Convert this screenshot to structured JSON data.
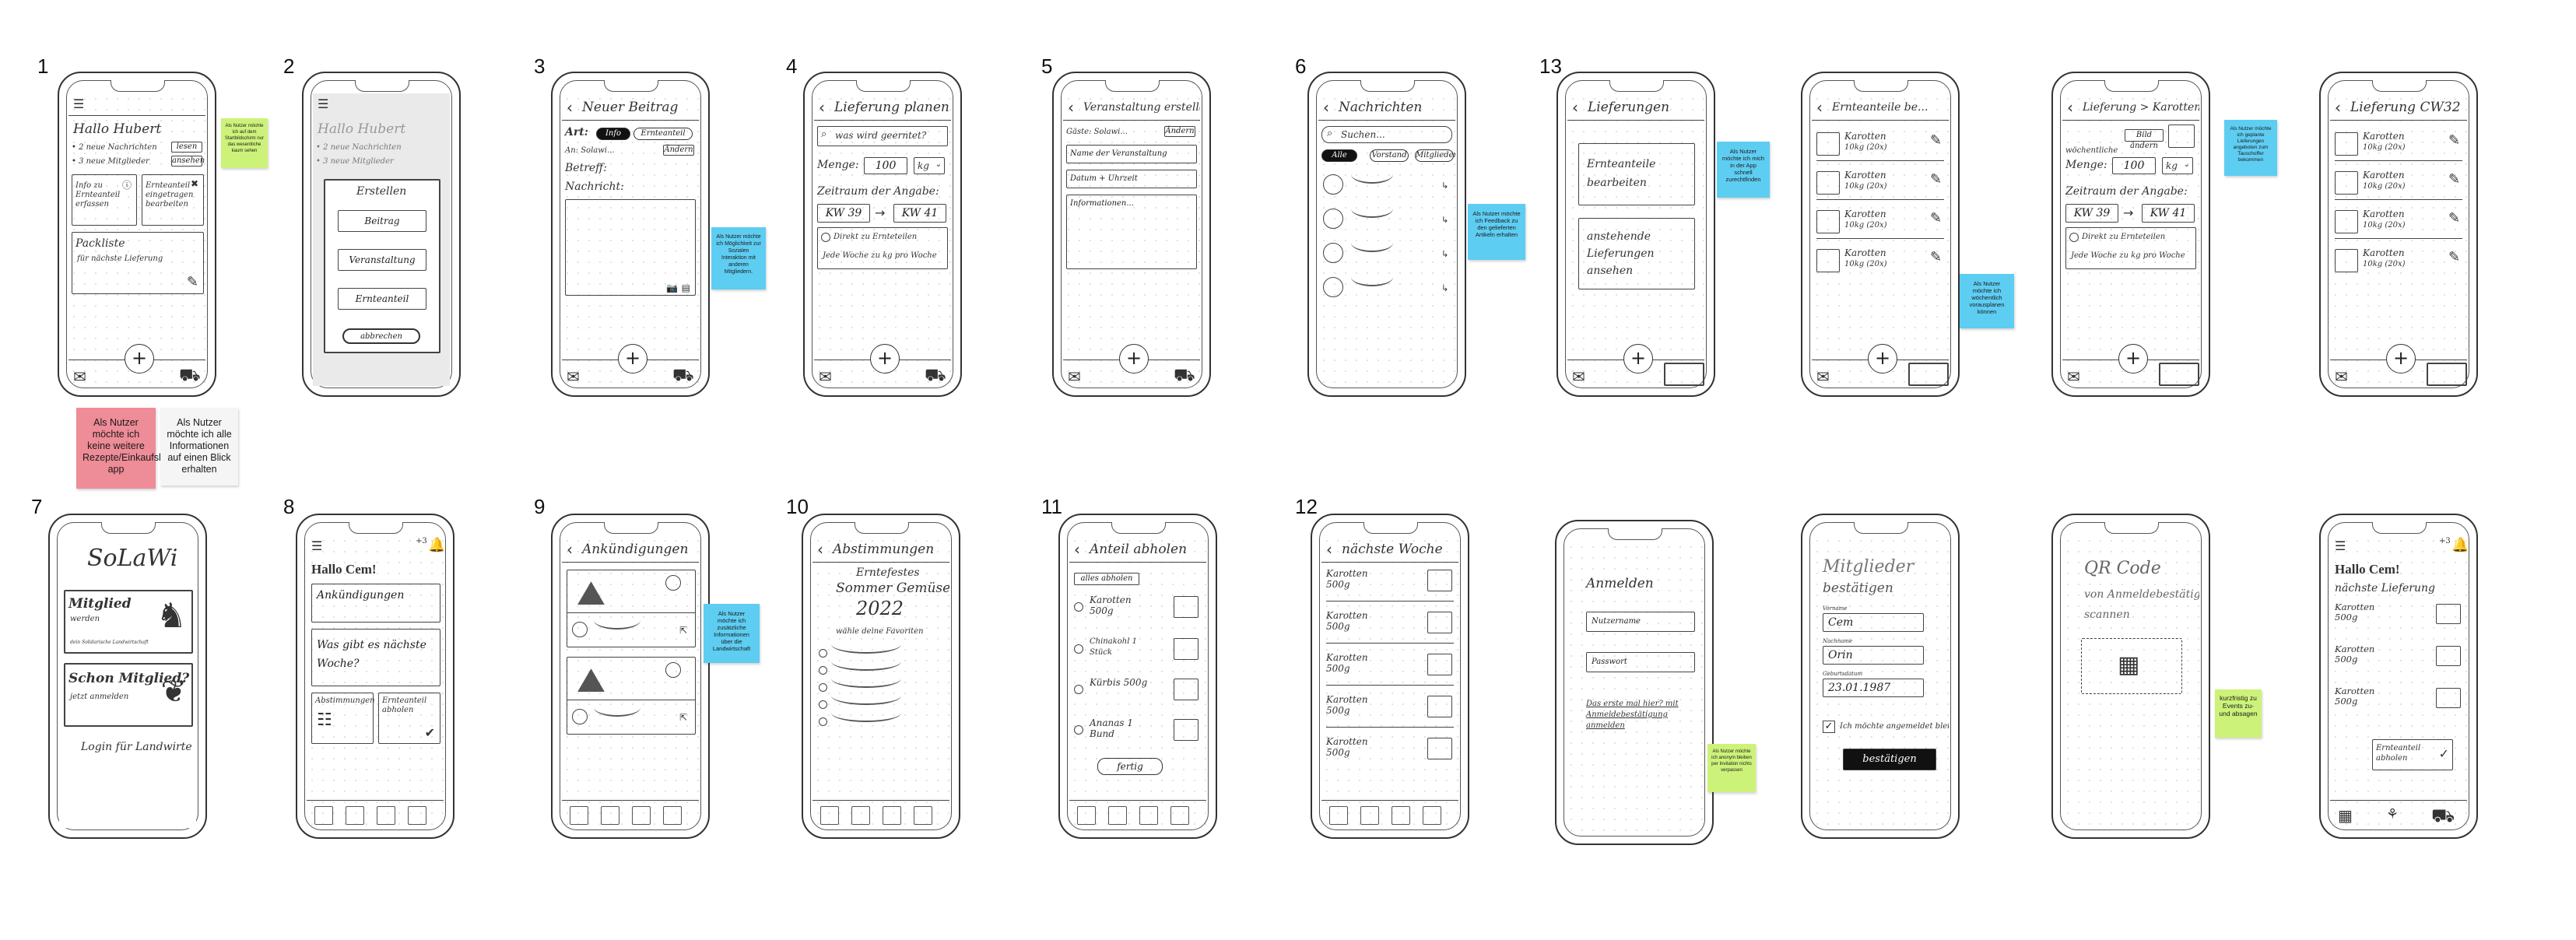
{
  "canvas_title": "",
  "labels": {
    "n1": "1",
    "n2": "2",
    "n3": "3",
    "n4": "4",
    "n5": "5",
    "n6": "6",
    "n13": "13",
    "n7": "7",
    "n8": "8",
    "n9": "9",
    "n10": "10",
    "n11": "11",
    "n12": "12"
  },
  "notes": {
    "s1_green": "Als Nutzer möchte ich auf dem Startbildschirm nur das wesentliche kaum sehen",
    "s3_blue": "Als Nutzer möchte ich Möglichkeit zur Sozialen Interaktion mit anderen Mitgliedern.",
    "s6_blue": "Als Nutzer möchte ich Feedback zu den gelieferten Artikeln erhalten",
    "s13_blue": "Als Nutzer möchte ich mich in der App schnell zurechtfinden",
    "s15_blue": "Als Nutzer möchte ich wöchentlich vorausplanen können",
    "s17_blue": "Als Nutzer möchte ich geplante Lieferungen angeboten zum Tauschoffer bekommen",
    "pink": "Als Nutzer möchte ich keine weitere Rezepte/Einkaufslisten app",
    "white": "Als Nutzer möchte ich alle Informationen auf einen Blick erhalten",
    "s9_blue": "Als Nutzer möchte ich zusätzliche Informationen über die Landwirtschaft",
    "s13b_green": "Als Nutzer möchte ich anonym bleiben per Invitation nichts verpassen",
    "s16_green": "kurzfristig zu Events zu- und absagen"
  },
  "s1": {
    "greeting": "Hallo Hubert",
    "line1": "• 2 neue Nachrichten",
    "line2": "• 3 neue Mitglieder",
    "btn_lesen": "lesen",
    "btn_ansehen": "ansehen",
    "card1": "Info zu Ernteanteil erfassen",
    "card2": "Ernteanteil eingetragen bearbeiten",
    "list_title": "Packliste",
    "list_sub": "für nächste Lieferung"
  },
  "s2": {
    "greeting": "Hallo Hubert",
    "line1": "• 2 neue Nachrichten",
    "line2": "• 3 neue Mitglieder",
    "menu_title": "Erstellen",
    "opt1": "Beitrag",
    "opt2": "Veranstaltung",
    "opt3": "Ernteanteil",
    "cancel": "abbrechen"
  },
  "s3": {
    "title": "Neuer Beitrag",
    "art_label": "Art:",
    "chip1": "Info",
    "chip2": "Ernteanteil",
    "an_label": "An: Solawi...",
    "an_btn": "Ändern",
    "betreff_label": "Betreff:",
    "nachricht_label": "Nachricht:"
  },
  "s4": {
    "title": "Lieferung planen",
    "search": "was wird geerntet?",
    "menge_label": "Menge:",
    "menge_val": "100",
    "unit": "kg",
    "zeitraum": "Zeitraum der Angabe:",
    "kw_from": "KW 39",
    "kw_to": "KW 41",
    "opt1": "Direkt zu Ernteteilen",
    "opt2": "Jede Woche zu kg pro Woche"
  },
  "s5": {
    "title": "Veranstaltung erstellen",
    "gaste": "Gäste: Solawi...",
    "gaste_btn": "Ändern",
    "f1": "Name der Veranstaltung",
    "f2": "Datum + Uhrzeit",
    "f3": "Informationen..."
  },
  "s6": {
    "title": "Nachrichten",
    "search": "Suchen...",
    "tab1": "Alle",
    "tab2": "Vorstand",
    "tab3": "Mitglieder"
  },
  "s13": {
    "title": "Lieferungen",
    "card1": "Ernteanteile bearbeiten",
    "card2": "anstehende Lieferungen ansehen"
  },
  "s14": {
    "title": "Ernteanteile be...",
    "item_name": "Karotten",
    "item_qty": "10kg (20x)"
  },
  "s15": {
    "title": "Lieferung > Karotten",
    "bild": "Bild ändern",
    "wochen": "wöchentliche",
    "menge_label": "Menge:",
    "menge_val": "100",
    "unit": "kg",
    "zeitraum": "Zeitraum der Angabe:",
    "kw_from": "KW 39",
    "kw_to": "KW 41",
    "opt1": "Direkt zu Ernteteilen",
    "opt2": "Jede Woche zu kg pro Woche"
  },
  "s16": {
    "title": "Lieferung CW32",
    "item_name": "Karotten",
    "item_qty": "10kg (20x)"
  },
  "s7": {
    "logo": "SoLaWi",
    "card1_title": "Mitglied",
    "card1_sub": "werden",
    "card1_hint": "dein Solidarische Landwirtschaft",
    "card2_title": "Schon Mitglied?",
    "card2_sub": "jetzt anmelden",
    "login": "Login für Landwirte"
  },
  "s8": {
    "badge": "+3",
    "greeting": "Hallo Cem!",
    "card1": "Ankündigungen",
    "card2": "Was gibt es nächste Woche?",
    "card3": "Abstimmungen",
    "card4": "Ernteanteil abholen"
  },
  "s9": {
    "title": "Ankündigungen"
  },
  "s10": {
    "title": "Abstimmungen",
    "head1": "Erntefestes",
    "head2": "Sommer Gemüse",
    "year": "2022",
    "prompt": "wähle deine Favoriten"
  },
  "s11": {
    "title": "Anteil abholen",
    "all_btn": "alles abholen",
    "i1": "Karotten 500g",
    "i2": "Chinakohl 1 Stück",
    "i3": "Kürbis 500g",
    "i4": "Ananas 1 Bund",
    "done": "fertig"
  },
  "s12": {
    "title": "nächste Woche",
    "item": "Karotten 500g"
  },
  "s17": {
    "title": "Anmelden",
    "user": "Nutzername",
    "pass": "Passwort",
    "link": "Das erste mal hier? mit Anmeldebestätigung anmelden"
  },
  "s18": {
    "title1": "Mitglieder",
    "title2": "bestätigen",
    "l1": "Vorname",
    "v1": "Cem",
    "l2": "Nachname",
    "v2": "Orin",
    "l3": "Geburtsdatum",
    "v3": "23.01.1987",
    "agree": "Ich möchte angemeldet bleiben",
    "btn": "bestätigen"
  },
  "s19": {
    "title1": "QR Code",
    "title2": "von Anmeldebestätigung",
    "title3": "scannen"
  },
  "s20": {
    "badge": "+3",
    "greeting": "Hallo Cem!",
    "sub": "nächste Lieferung",
    "item": "Karotten 500g",
    "btn": "Ernteanteil abholen"
  }
}
